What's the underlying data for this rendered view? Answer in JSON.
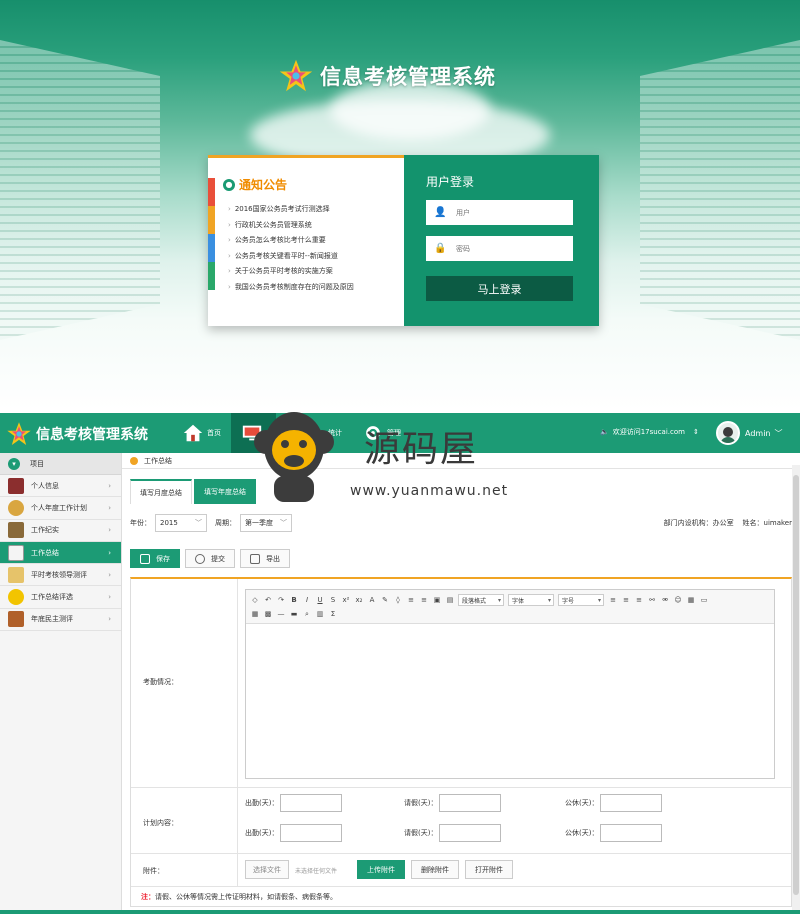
{
  "login_page": {
    "system_title": "信息考核管理系统",
    "notice_title": "通知公告",
    "notice_items": [
      "2016国家公务员考试行测选择",
      "行政机关公务员管理系统",
      "公务员怎么考核比考什么重要",
      "公务员考核关键看平时--新闻报道",
      "关于公务员平时考核的实施方案",
      "我国公务员考核制度存在的问题及原因"
    ],
    "login_title": "用户登录",
    "username_placeholder": "用户",
    "password_placeholder": "密码",
    "login_button": "马上登录"
  },
  "app": {
    "system_title": "信息考核管理系统",
    "nav": [
      {
        "label": "首页",
        "icon": "home-icon"
      },
      {
        "label": "",
        "icon": "screen-icon"
      },
      {
        "label": "",
        "icon": "folder-icon"
      },
      {
        "label": "统计",
        "icon": "chart-icon"
      },
      {
        "label": "管理",
        "icon": "gear-icon"
      }
    ],
    "welcome_text": "欢迎访问17sucai.com",
    "user_name": "Admin",
    "sidebar_header": "项目",
    "sidebar_items": [
      {
        "label": "个人信息",
        "icon": "book-icon",
        "color": "#8b2e2e"
      },
      {
        "label": "个人年度工作计划",
        "icon": "clock-icon",
        "color": "#d9a640"
      },
      {
        "label": "工作纪实",
        "icon": "briefcase-icon",
        "color": "#8a6a3a"
      },
      {
        "label": "工作总结",
        "icon": "clipboard-icon",
        "color": "#e8e8e8"
      },
      {
        "label": "平时考核领导测评",
        "icon": "notepad-icon",
        "color": "#e6c36a"
      },
      {
        "label": "工作总结评选",
        "icon": "smiley-icon",
        "color": "#f2c400"
      },
      {
        "label": "年底民主测评",
        "icon": "bag-icon",
        "color": "#b0602a"
      }
    ],
    "active_sidebar_index": 3,
    "breadcrumb": "工作总结",
    "tabs": [
      "填写月度总结",
      "填写年度总结"
    ],
    "filters": {
      "year_label": "年份：",
      "year_value": "2015",
      "period_label": "周期：",
      "period_value": "第一季度",
      "dept_label": "部门内设机构：",
      "dept_value": "办公室",
      "name_label": "姓名：",
      "name_value": "uimaker"
    },
    "actions": [
      "保存",
      "提交",
      "导出"
    ],
    "form": {
      "attendance_label": "考勤情况：",
      "plan_label": "计划内容：",
      "plan_fields": [
        {
          "label": "出勤(天)："
        },
        {
          "label": "请假(天)："
        },
        {
          "label": "公休(天)："
        },
        {
          "label": "出勤(天)："
        },
        {
          "label": "请假(天)："
        },
        {
          "label": "公休(天)："
        }
      ],
      "attachment_label": "附件：",
      "choose_file": "选择文件",
      "no_file_text": "未选择任何文件",
      "upload_button": "上传附件",
      "delete_button": "删除附件",
      "open_button": "打开附件",
      "note_prefix": "注：",
      "note_text": "请假、公休等情况需上传证明材料，如请假条、病假条等。"
    },
    "editor_dropdowns": [
      "段落格式",
      "字体",
      "字号"
    ],
    "accent_color": "#1c9b75",
    "highlight_color": "#f0a424"
  },
  "watermark": {
    "text": "源码屋",
    "url": "www.yuanmawu.net"
  }
}
